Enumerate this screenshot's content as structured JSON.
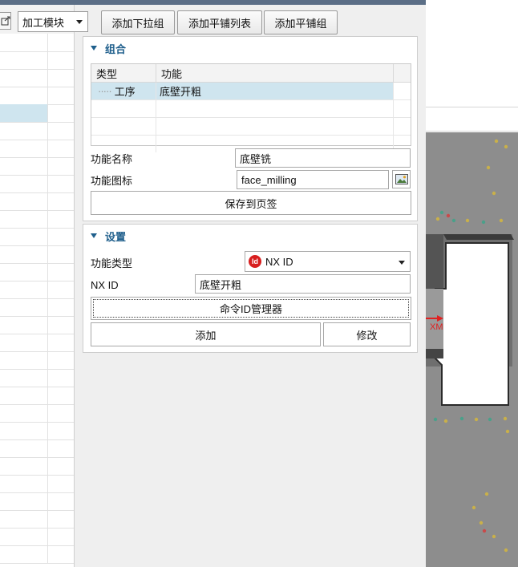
{
  "toolbar": {
    "module_dropdown": "加工模块",
    "add_dropdown_group": "添加下拉组",
    "add_flat_list": "添加平铺列表",
    "add_flat_group": "添加平铺组"
  },
  "group_section": {
    "title": "组合",
    "table": {
      "headers": [
        "类型",
        "功能"
      ],
      "rows": [
        {
          "type": "工序",
          "function": "底壁开粗"
        }
      ]
    },
    "function_name_label": "功能名称",
    "function_name_value": "底壁铣",
    "function_icon_label": "功能图标",
    "function_icon_value": "face_milling",
    "save_button": "保存到页签"
  },
  "settings_section": {
    "title": "设置",
    "function_type_label": "功能类型",
    "function_type_value": "NX ID",
    "nxid_label": "NX ID",
    "nxid_value": "底壁开粗",
    "cmd_manager_button": "命令ID管理器",
    "add_button": "添加",
    "modify_button": "修改"
  },
  "viewport": {
    "axis_label": "XM"
  },
  "colors": {
    "accent": "#1f5f8c",
    "selection": "#cfe5ef",
    "viewport_bg": "#8d8d8d",
    "axis": "#e02020"
  }
}
